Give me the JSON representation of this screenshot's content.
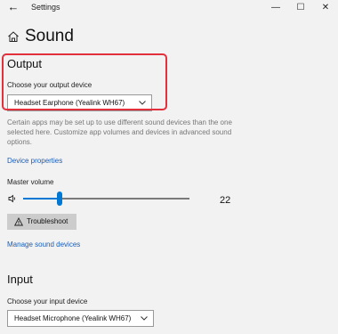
{
  "window": {
    "back_symbol": "←",
    "title": "Settings",
    "controls": [
      "—",
      "☐",
      "✕"
    ]
  },
  "page": {
    "title": "Sound"
  },
  "output": {
    "title": "Output",
    "device_label": "Choose your output device",
    "device_value": "Headset Earphone (Yealink WH67)",
    "description": "Certain apps may be set up to use different sound devices than the one selected here. Customize app volumes and devices in advanced sound options.",
    "properties_link": "Device properties",
    "volume_label": "Master volume",
    "volume_value": "22",
    "volume_level": 0.22,
    "troubleshoot_label": "Troubleshoot",
    "manage_link": "Manage sound devices"
  },
  "input": {
    "title": "Input",
    "device_label": "Choose your input device",
    "device_value": "Headset Microphone (Yealink WH67)"
  },
  "colors": {
    "accent": "#0078d4",
    "link": "#1a5db8",
    "highlight": "#e3303d"
  },
  "icons": [
    "back-arrow-icon",
    "minimize-icon",
    "maximize-icon",
    "close-icon",
    "home-icon",
    "chevron-down-icon",
    "speaker-icon",
    "warning-icon"
  ]
}
